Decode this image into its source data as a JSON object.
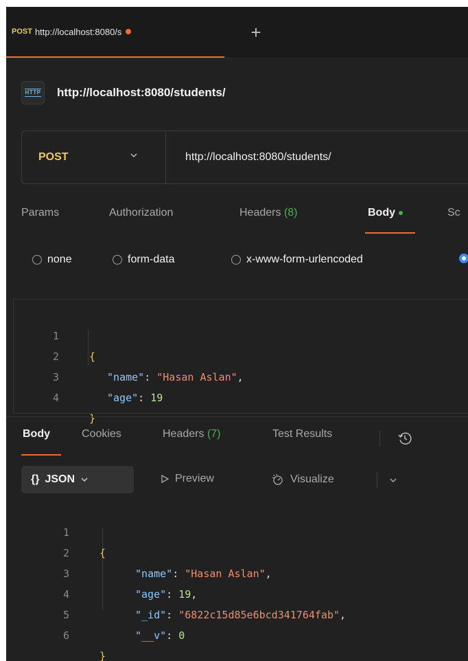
{
  "tab": {
    "method": "POST",
    "url": "http://localhost:8080/s",
    "new_tab_symbol": "+"
  },
  "request": {
    "icon_text": "HTTP",
    "title": "http://localhost:8080/students/",
    "method": "POST",
    "url": "http://localhost:8080/students/"
  },
  "request_tabs": {
    "params": "Params",
    "authorization": "Authorization",
    "headers": "Headers",
    "headers_count": "(8)",
    "body": "Body",
    "scripts": "Sc"
  },
  "body_types": {
    "none": "none",
    "form_data": "form-data",
    "urlencoded": "x-www-form-urlencoded",
    "selected": "raw"
  },
  "request_body": {
    "line_numbers": [
      "1",
      "2",
      "3",
      "4"
    ],
    "open": "{",
    "close": "}",
    "name_key": "\"name\"",
    "name_value": "\"Hasan Aslan\"",
    "age_key": "\"age\"",
    "age_value": "19"
  },
  "response_tabs": {
    "body": "Body",
    "cookies": "Cookies",
    "headers": "Headers",
    "headers_count": "(7)",
    "test_results": "Test Results"
  },
  "response_toolbar": {
    "format_icon": "{}",
    "format": "JSON",
    "preview": "Preview",
    "visualize": "Visualize"
  },
  "response_body": {
    "line_numbers": [
      "1",
      "2",
      "3",
      "4",
      "5",
      "6"
    ],
    "open": "{",
    "close": "}",
    "name_key": "\"name\"",
    "name_value": "\"Hasan Aslan\"",
    "age_key": "\"age\"",
    "age_value": "19",
    "id_key": "\"_id\"",
    "id_value": "\"6822c15d85e6bcd341764fab\"",
    "v_key": "\"__v\"",
    "v_value": "0"
  },
  "colors": {
    "accent": "#f26b3a",
    "method_post": "#f0c85a",
    "success": "#4caf50",
    "selected_radio": "#3d8bff"
  }
}
